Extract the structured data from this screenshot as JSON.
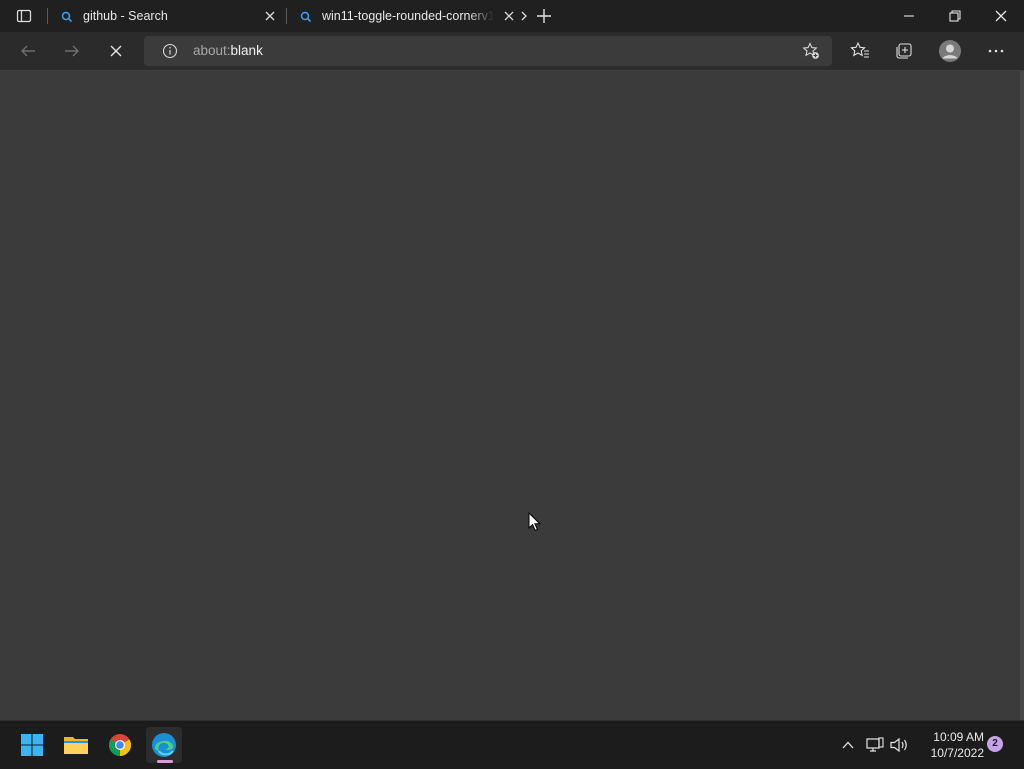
{
  "browser": {
    "tabs": [
      {
        "title": "github - Search",
        "favicon": "search-icon"
      },
      {
        "title": "win11-toggle-rounded-cornerv1",
        "favicon": "search-icon"
      }
    ],
    "address": {
      "scheme": "about:",
      "path": "blank"
    },
    "icons": {
      "tab_actions": "tab-actions-icon",
      "new_tab": "plus-icon",
      "back": "back-arrow-icon",
      "forward": "forward-arrow-icon",
      "stop": "stop-icon",
      "info": "info-icon",
      "add_favorite": "add-favorite-icon",
      "favorites": "favorites-icon",
      "collections": "collections-icon",
      "profile": "profile-avatar",
      "more": "more-icon"
    }
  },
  "taskbar": {
    "apps": [
      "start",
      "file-explorer",
      "chrome",
      "edge"
    ],
    "clock": {
      "time": "10:09 AM",
      "date": "10/7/2022"
    },
    "notification_count": "2"
  },
  "colors": {
    "tabstrip": "#202020",
    "toolbar": "#2b2b2b",
    "page": "#3b3b3b",
    "taskbar": "#1c1c1c",
    "accent": "#0078d4",
    "badge": "#c8a2e6"
  }
}
